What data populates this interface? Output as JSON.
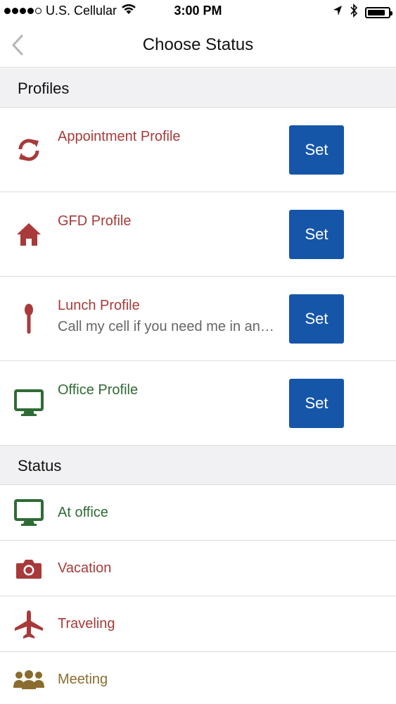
{
  "status_bar": {
    "carrier": "U.S. Cellular",
    "time": "3:00 PM",
    "signal_bars_filled": 4,
    "signal_bars_total": 5,
    "battery_level": 0.85,
    "icons": [
      "wifi-icon",
      "location-arrow-icon",
      "bluetooth-icon",
      "battery-icon"
    ]
  },
  "nav": {
    "title": "Choose Status",
    "back_icon": "chevron-left-icon"
  },
  "colors": {
    "red": "#a83a3a",
    "green": "#2f6b35",
    "gold": "#8a6d2e",
    "button_blue": "#1656a8",
    "header_bg": "#f1f1f3"
  },
  "profiles_section": {
    "header": "Profiles",
    "items": [
      {
        "title": "Appointment Profile",
        "subtitle": "",
        "icon": "refresh-icon",
        "color": "#a83a3a",
        "button": "Set"
      },
      {
        "title": "GFD Profile",
        "subtitle": "",
        "icon": "home-icon",
        "color": "#a83a3a",
        "button": "Set"
      },
      {
        "title": "Lunch Profile",
        "subtitle": "Call my cell if you need me in an…",
        "icon": "spoon-icon",
        "color": "#a83a3a",
        "button": "Set"
      },
      {
        "title": "Office Profile",
        "subtitle": "",
        "icon": "desktop-icon",
        "color": "#2f6b35",
        "button": "Set"
      }
    ]
  },
  "status_section": {
    "header": "Status",
    "items": [
      {
        "label": "At office",
        "icon": "desktop-icon",
        "color": "#2f6b35"
      },
      {
        "label": "Vacation",
        "icon": "camera-icon",
        "color": "#a83a3a"
      },
      {
        "label": "Traveling",
        "icon": "plane-icon",
        "color": "#a83a3a"
      },
      {
        "label": "Meeting",
        "icon": "group-icon",
        "color": "#8a6d2e"
      }
    ]
  }
}
